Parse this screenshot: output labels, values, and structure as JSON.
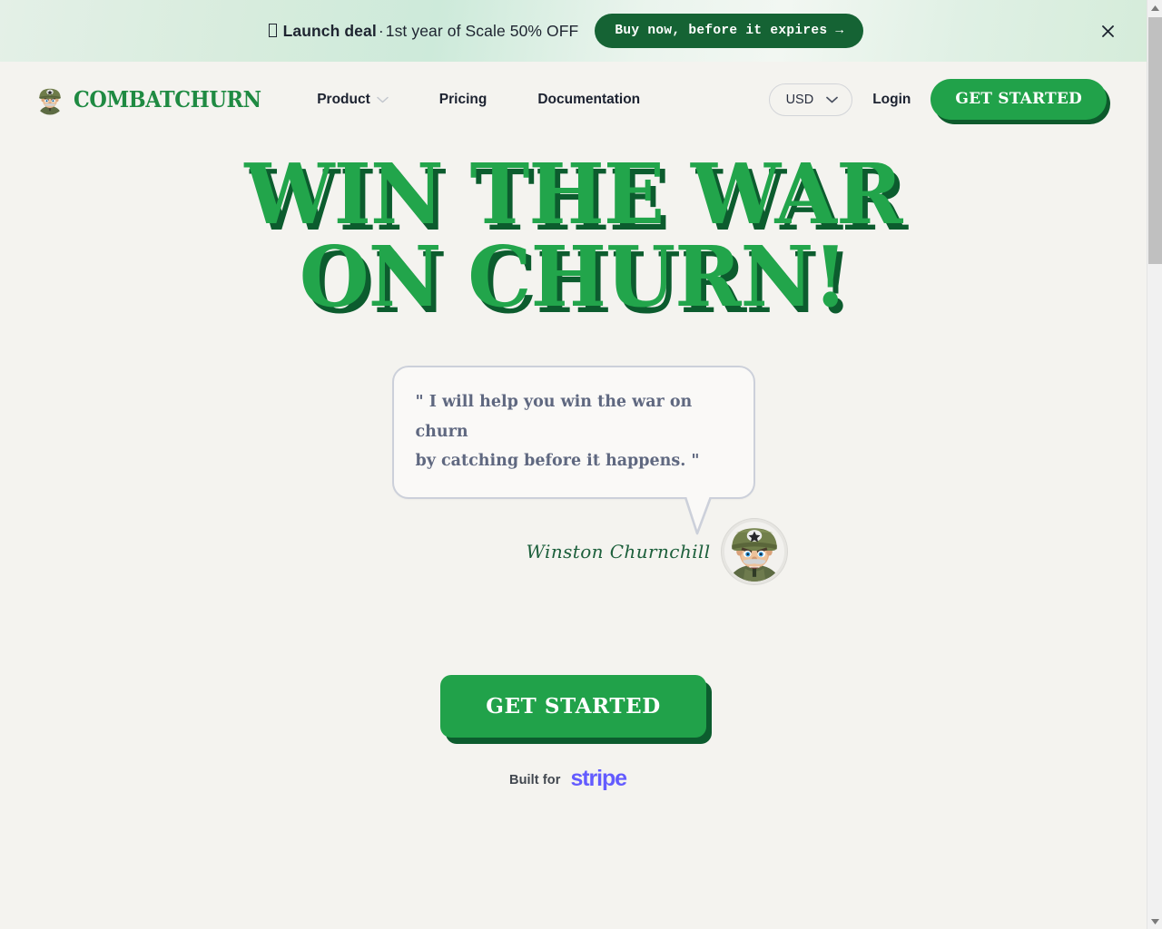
{
  "banner": {
    "icon": "missing-glyph-box",
    "strong_text": "Launch deal",
    "separator": "·",
    "rest_text": "1st year of Scale 50% OFF",
    "cta_label": "Buy now, before it expires →",
    "close_icon": "close-icon",
    "bg_color": "#d7ecdd",
    "cta_bg": "#156334"
  },
  "nav": {
    "brand_name": "COMBATCHURN",
    "brand_icon": "soldier-avatar-icon",
    "brand_color": "#1f8a42",
    "links": [
      {
        "label": "Product",
        "has_dropdown": true
      },
      {
        "label": "Pricing",
        "has_dropdown": false
      },
      {
        "label": "Documentation",
        "has_dropdown": false
      }
    ],
    "currency": "USD",
    "currency_icon": "chevron-down-icon",
    "login_label": "Login",
    "cta_label": "GET STARTED"
  },
  "hero": {
    "headline_line1": "WIN THE WAR",
    "headline_line2": "ON CHURN!",
    "headline_color": "#22a54b",
    "headline_shadow_color": "#0c5c2e",
    "quote_line1": "\" I will help you win the war on churn",
    "quote_line2": "by catching before it happens. \"",
    "signature": "Winston Churnchill",
    "signature_color": "#1c5f3b",
    "avatar_icon": "general-avatar",
    "cta_label": "GET STARTED",
    "built_for_label": "Built for",
    "stripe_label": "stripe",
    "stripe_color": "#635bff"
  },
  "scrollbar": {
    "up_arrow_icon": "triangle-up-icon",
    "down_arrow_icon": "triangle-down-icon",
    "thumb": "scrollbar-thumb"
  }
}
